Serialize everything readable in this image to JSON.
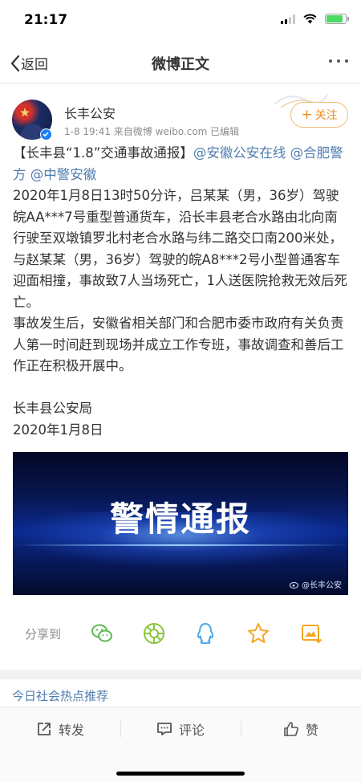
{
  "status_bar": {
    "time": "21:17",
    "battery_level": 0.85
  },
  "nav": {
    "back_label": "返回",
    "title": "微博正文"
  },
  "author": {
    "avatar_text": "长丰公安",
    "name": "长丰公安",
    "meta": "1-8 19:41  来自微博 weibo.com  已编辑",
    "follow_label": "关注"
  },
  "post": {
    "title": "【长丰县“1.8”交通事故通报】",
    "mentions": [
      "@安徽公安在线",
      "@合肥警方",
      "@中警安徽"
    ],
    "paragraph1": "2020年1月8日13时50分许，吕某某（男，36岁）驾驶皖AA***7号重型普通货车，沿长丰县老合水路由北向南行驶至双墩镇罗北村老合水路与纬二路交口南200米处，与赵某某（男，36岁）驾驶的皖A8***2号小型普通客车迎面相撞，事故致7人当场死亡，1人送医院抢救无效后死亡。",
    "paragraph2": "事故发生后，安徽省相关部门和合肥市委市政府有关负责人第一时间赶到现场并成立工作专班，事故调查和善后工作正在积极开展中。",
    "signature": "长丰县公安局",
    "date": "2020年1月8日"
  },
  "image": {
    "title": "警情通报",
    "watermark": "@长丰公安"
  },
  "share": {
    "label": "分享到"
  },
  "hot_link": "今日社会热点推荐",
  "actions": {
    "repost": "转发",
    "comment": "评论",
    "like": "赞"
  },
  "colors": {
    "link": "#507daf",
    "follow": "#f08a1c",
    "verified": "#1d7ef6"
  }
}
